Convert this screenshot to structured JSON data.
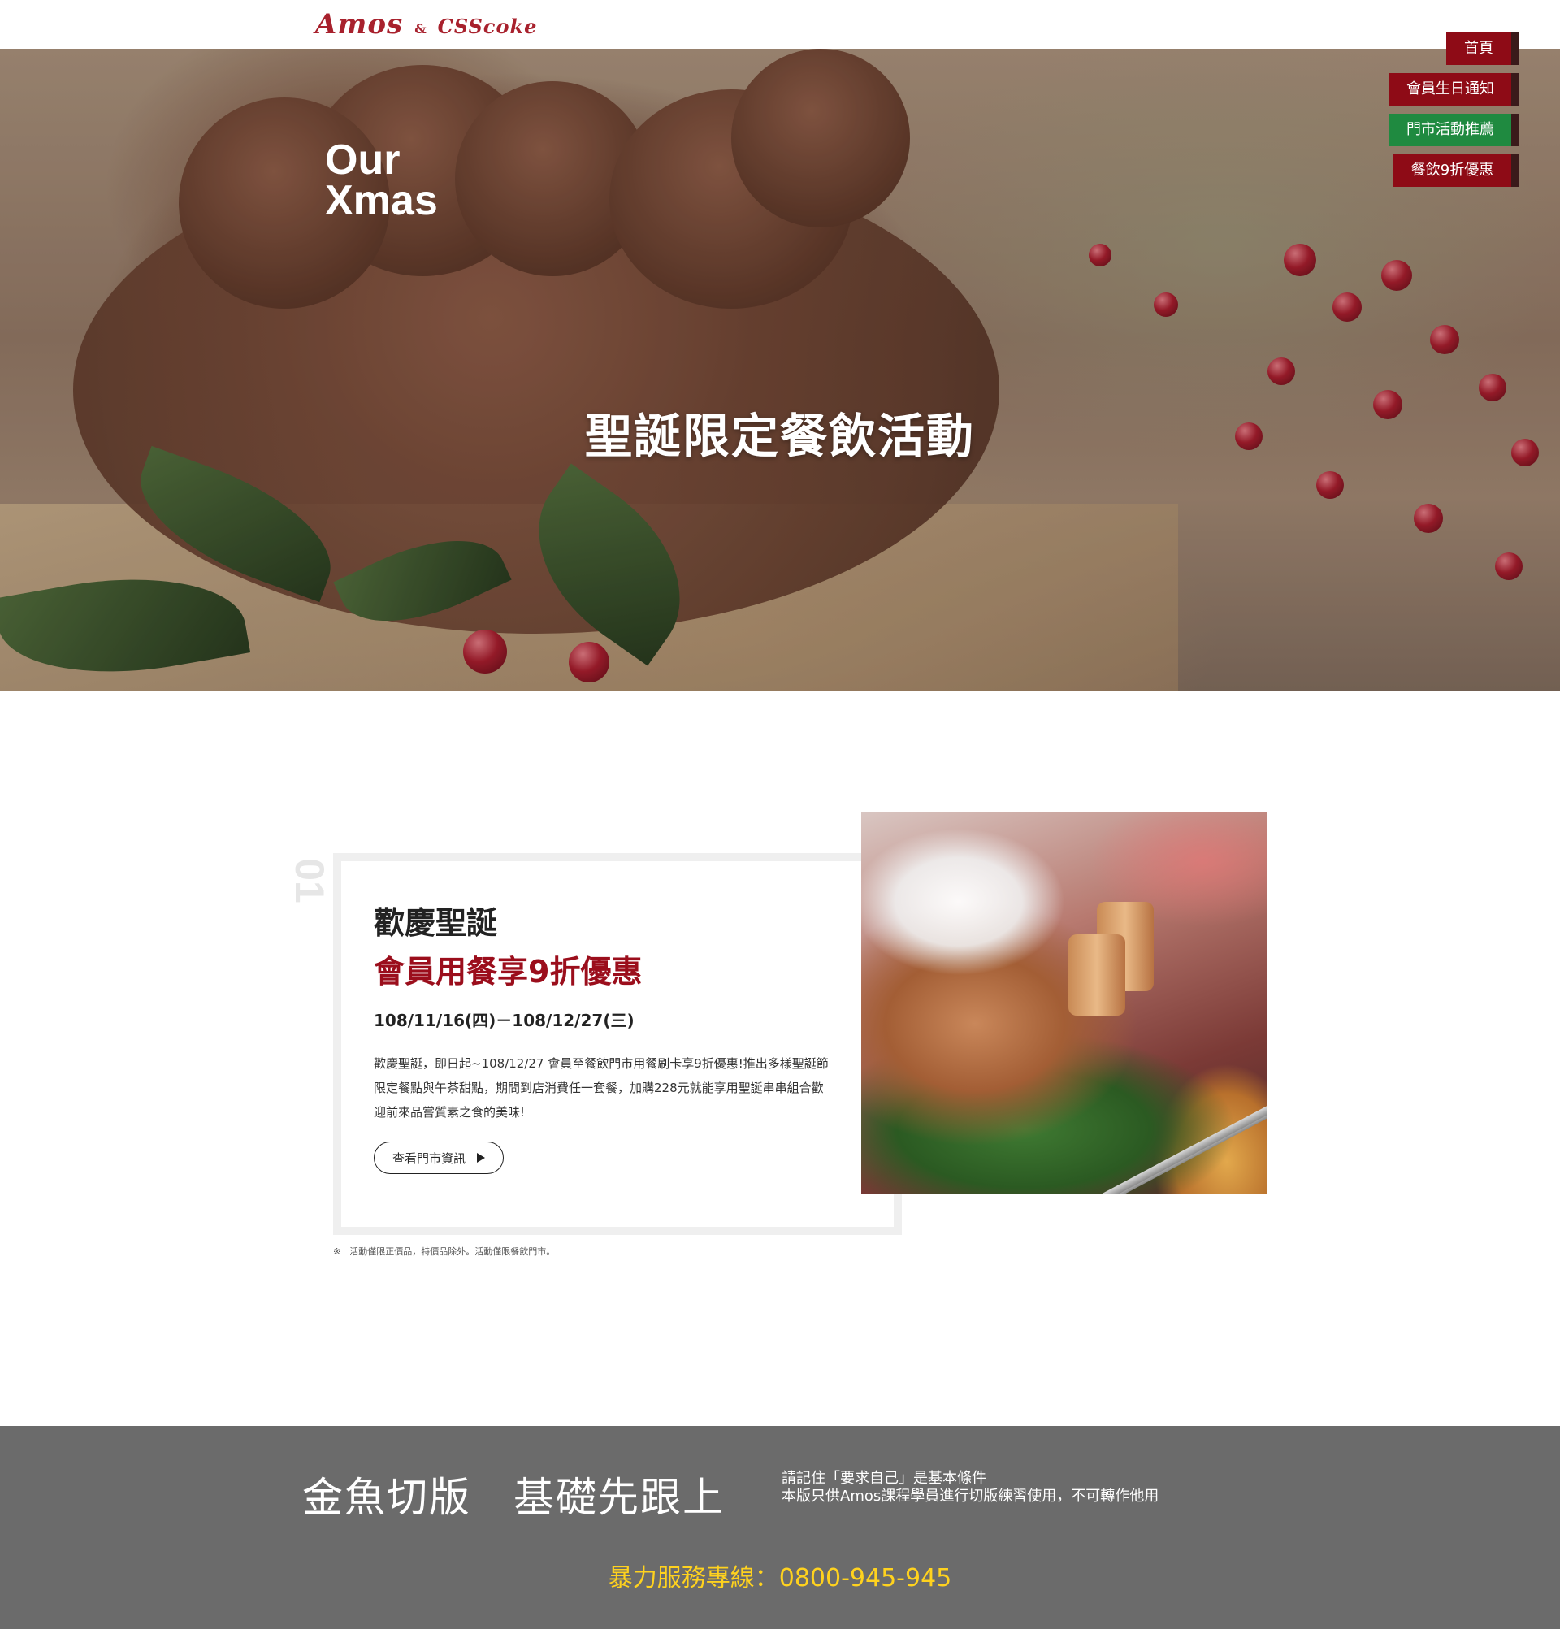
{
  "header": {
    "logo_amos": "Amos",
    "logo_amp": "&",
    "logo_csscoke": "CSScoke"
  },
  "hero": {
    "brand_line1": "Our",
    "brand_line2": "Xmas",
    "title": "聖誕限定餐飲活動"
  },
  "nav": {
    "items": [
      {
        "label": "首頁",
        "color": "#8e0b16"
      },
      {
        "label": "會員生日通知",
        "color": "#8e0b16"
      },
      {
        "label": "門市活動推薦",
        "color": "#1f8a40"
      },
      {
        "label": "餐飲9折優惠",
        "color": "#8e0b16"
      }
    ]
  },
  "promo": {
    "number": "01",
    "heading": "歡慶聖誕",
    "subheading": "會員用餐享9折優惠",
    "date": "108/11/16(四)－108/12/27(三)",
    "description": "歡慶聖誕，即日起~108/12/27 會員至餐飲門市用餐刷卡享9折優惠!推出多樣聖誕節限定餐點與午茶甜點，期間到店消費任一套餐，加購228元就能享用聖誕串串組合歡迎前來品嘗質素之食的美味!",
    "button_label": "查看門市資訊",
    "note": "※　活動僅限正價品，特價品除外。活動僅限餐飲門市。",
    "accent_color": "#9b0e1c"
  },
  "footer": {
    "slogan": "金魚切版　基礎先跟上",
    "note_line1": "請記住「要求自己」是基本條件",
    "note_line2": "本版只供Amos課程學員進行切版練習使用，不可轉作他用",
    "hotline": "暴力服務專線：0800-945-945",
    "hotline_color": "#ffd21e"
  }
}
